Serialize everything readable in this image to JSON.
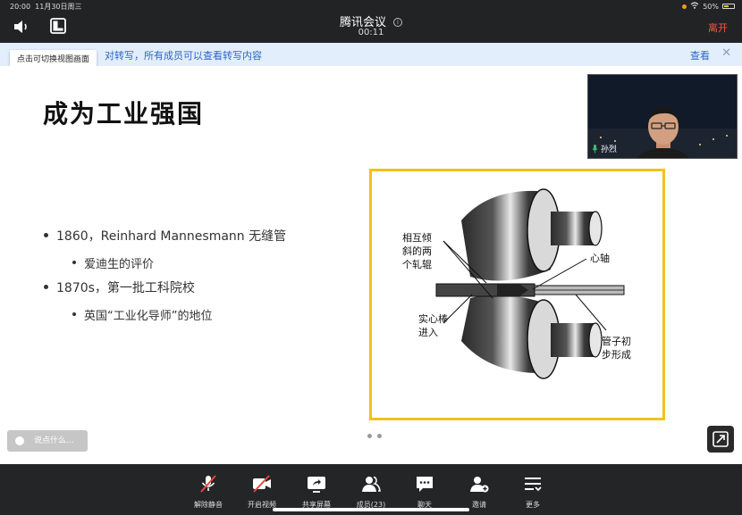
{
  "status_bar": {
    "time": "20:00",
    "date": "11月30日周三",
    "battery": "50%"
  },
  "header": {
    "title": "腾讯会议",
    "timer": "00:11",
    "leave_label": "离开"
  },
  "notice": {
    "text": "对转写，所有成员可以查看转写内容",
    "view_label": "查看",
    "close_icon": "close-icon"
  },
  "tooltip": {
    "text": "点击可切换视图画面"
  },
  "slide": {
    "title": "成为工业强国",
    "bullets": [
      "1860，Reinhard Mannesmann 无缝管",
      "爱迪生的评价",
      "1870s，第一批工科院校",
      "英国“工业化导师”的地位"
    ],
    "figure_labels": {
      "rollers": [
        "相互倾",
        "斜的两",
        "个轧辊"
      ],
      "mandrel": "心轴",
      "solid_bar": [
        "实心棒",
        "进入"
      ],
      "tube": [
        "管子初",
        "步形成"
      ]
    }
  },
  "chat": {
    "placeholder": "说点什么..."
  },
  "participant": {
    "name": "孙烈"
  },
  "toolbar": {
    "items": [
      {
        "label": "解除静音",
        "icon": "mic-muted-icon"
      },
      {
        "label": "开启视频",
        "icon": "camera-off-icon"
      },
      {
        "label": "共享屏幕",
        "icon": "share-screen-icon"
      },
      {
        "label": "成员(23)",
        "icon": "members-icon"
      },
      {
        "label": "聊天",
        "icon": "chat-icon"
      },
      {
        "label": "邀请",
        "icon": "invite-icon"
      },
      {
        "label": "更多",
        "icon": "more-icon"
      }
    ]
  },
  "colors": {
    "accent": "#2c66c7",
    "leave": "#f05a47",
    "figure_border": "#f3c21c",
    "toolbar_bg": "#242527"
  }
}
